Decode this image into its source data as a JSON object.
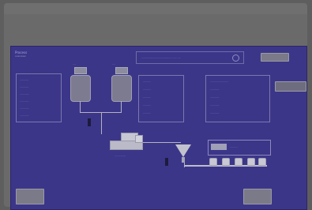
{
  "screen": {
    "title": "Process",
    "subtitle": "overview",
    "banner": "........................................  ......  ....",
    "top_right_button": "",
    "right_side_button": "",
    "bottom_left_button": "",
    "bottom_right_button": ""
  },
  "panels": {
    "left": [
      "............",
      "............",
      "............",
      "............",
      "............",
      "............"
    ],
    "middle": [
      "..........",
      "..........",
      "..........",
      "..........",
      ".........."
    ],
    "right": [
      "........................",
      "............",
      "............",
      "............",
      "............"
    ]
  },
  "labels": {
    "tank1": "....",
    "tank2": "....",
    "mixer": "...............",
    "filler_panel": "..........",
    "dropper": "..."
  },
  "colors": {
    "screen_bg": "#3c3689",
    "window_bg": "#6a6a6a",
    "panel_border": "#7a78ad",
    "button_bg": "#7b7a88"
  }
}
